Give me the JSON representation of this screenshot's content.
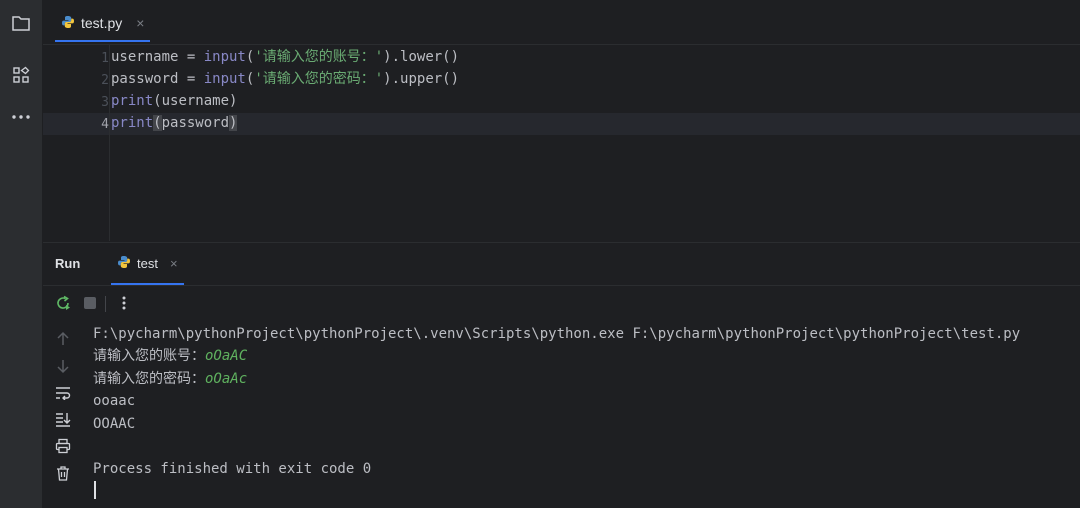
{
  "editor": {
    "tab_label": "test.py",
    "tab_close": "×",
    "line_numbers": [
      "1",
      "2",
      "3",
      "4"
    ],
    "lines": [
      {
        "a": "username = ",
        "fn": "input",
        "b": "(",
        "s": "'请输入您的账号：'",
        "c": ").lower()"
      },
      {
        "a": "password = ",
        "fn": "input",
        "b": "(",
        "s": "'请输入您的密码：'",
        "c": ").upper()"
      },
      {
        "fn": "print",
        "b": "(username)"
      },
      {
        "fn": "print",
        "p1": "(",
        "mid": "password",
        "p2": ")"
      }
    ]
  },
  "run": {
    "title": "Run",
    "tab_label": "test",
    "tab_close": "×",
    "console": {
      "command": "F:\\pycharm\\pythonProject\\pythonProject\\.venv\\Scripts\\python.exe F:\\pycharm\\pythonProject\\pythonProject\\test.py",
      "prompt1": "请输入您的账号：",
      "input1": "oOaAC",
      "prompt2": "请输入您的密码：",
      "input2": "oOaAc",
      "out1": "ooaac",
      "out2": "OOAAC",
      "finish": "Process finished with exit code 0"
    }
  },
  "colors": {
    "accent": "#3574f0",
    "function": "#8888c6",
    "string": "#6aab73",
    "user_input": "#5fb15f",
    "background": "#1e1f22"
  }
}
